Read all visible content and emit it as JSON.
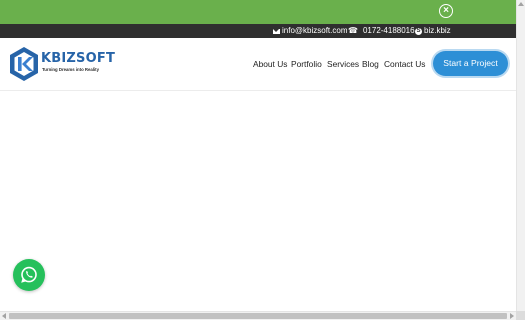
{
  "banner": {
    "color": "#6ab04c",
    "close_icon": "close-circle-icon"
  },
  "contact": {
    "email": "info@kbizsoft.com",
    "phone": "0172-4188016",
    "skype": "biz.kbiz",
    "email_icon": "envelope-icon",
    "phone_icon": "phone-icon",
    "skype_icon": "skype-icon"
  },
  "logo": {
    "name": "KBIZSOFT",
    "tagline": "Turning Dreams into Reality",
    "brand_color": "#2764a8"
  },
  "nav": {
    "items": [
      {
        "label": "About Us"
      },
      {
        "label": "Portfolio"
      },
      {
        "label": "Services"
      },
      {
        "label": "Blog"
      },
      {
        "label": "Contact Us"
      }
    ],
    "cta_label": "Start a Project",
    "cta_color": "#2d8fd6"
  },
  "whatsapp": {
    "icon": "whatsapp-icon",
    "color": "#25c05b"
  }
}
